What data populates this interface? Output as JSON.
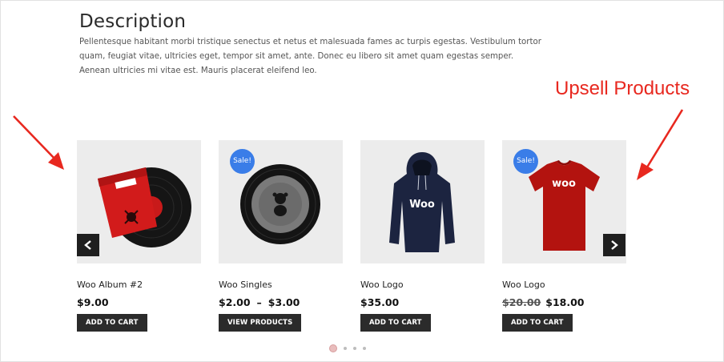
{
  "description": {
    "title": "Description",
    "body": "Pellentesque habitant morbi tristique senectus et netus et malesuada fames ac turpis egestas. Vestibulum tortor quam, feugiat vitae, ultricies eget, tempor sit amet, ante. Donec eu libero sit amet quam egestas semper. Aenean ultricies mi vitae est. Mauris placerat eleifend leo."
  },
  "annotation": {
    "label": "Upsell Products",
    "color": "#e8281f"
  },
  "products": [
    {
      "name": "Woo Album #2",
      "price": "$9.00",
      "button": "ADD TO CART",
      "sale": "",
      "image": "vinyl-album-image"
    },
    {
      "name": "Woo Singles",
      "price_from": "$2.00",
      "price_sep": "–",
      "price_to": "$3.00",
      "button": "VIEW PRODUCTS",
      "sale": "Sale!",
      "image": "vinyl-single-image"
    },
    {
      "name": "Woo Logo",
      "price": "$35.00",
      "button": "ADD TO CART",
      "sale": "",
      "image": "hoodie-image"
    },
    {
      "name": "Woo Logo",
      "price_old": "$20.00",
      "price": "$18.00",
      "button": "ADD TO CART",
      "sale": "Sale!",
      "image": "tshirt-image"
    }
  ],
  "shirt_text": "woo",
  "hoodie_text": "Woo",
  "carousel": {
    "dots": 4,
    "active": 0,
    "prev_icon": "chevron-left-icon",
    "next_icon": "chevron-right-icon"
  },
  "colors": {
    "sale_badge": "#3a7de8",
    "button": "#2b2b2b",
    "nav": "#1f1f1f",
    "shirt": "#b3130f",
    "hoodie": "#1c2440"
  }
}
